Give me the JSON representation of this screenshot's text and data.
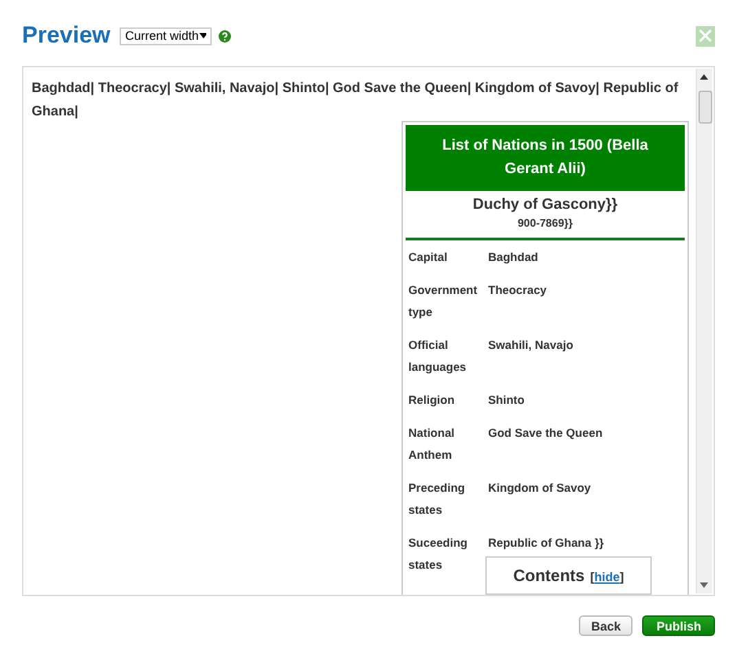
{
  "header": {
    "title": "Preview",
    "width_select": {
      "value": "Current width"
    }
  },
  "preview": {
    "summary": "Baghdad| Theocracy| Swahili, Navajo| Shinto| God Save the Queen| Kingdom of Savoy| Republic of Ghana|",
    "infobox": {
      "title": "List of Nations in 1500 (Bella Gerant Alii)",
      "name": "Duchy of Gascony}}",
      "subtitle": "900-7869}}",
      "rows": [
        {
          "label": "Capital",
          "value": "Baghdad"
        },
        {
          "label": "Government type",
          "value": "Theocracy"
        },
        {
          "label": "Official languages",
          "value": "Swahili, Navajo"
        },
        {
          "label": "Religion",
          "value": "Shinto"
        },
        {
          "label": "National Anthem",
          "value": "God Save the Queen"
        },
        {
          "label": "Preceding states",
          "value": "Kingdom of Savoy"
        },
        {
          "label": "Suceeding states",
          "value": "Republic of Ghana }}"
        }
      ]
    },
    "toc": {
      "title": "Contents",
      "toggle": {
        "open": "[",
        "link": "hide",
        "close": "]"
      }
    }
  },
  "buttons": [
    {
      "label": "Back",
      "kind": "secondary"
    },
    {
      "label": "Publish",
      "kind": "primary"
    }
  ]
}
